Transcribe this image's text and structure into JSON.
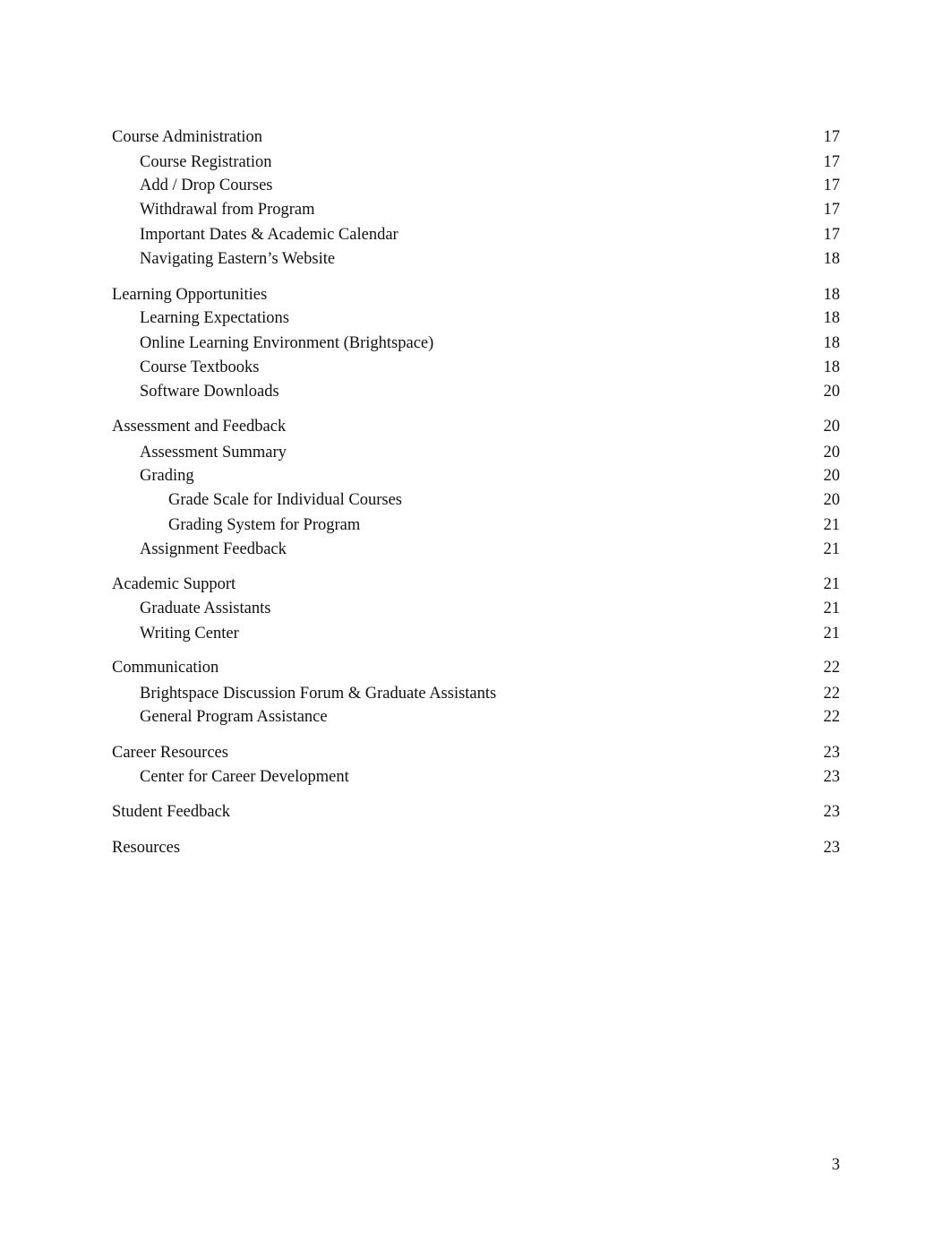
{
  "toc": {
    "entries": [
      {
        "title": "Course Administration",
        "page": "17",
        "level": 1
      },
      {
        "title": "Course Registration",
        "page": "17",
        "level": 2
      },
      {
        "title": "Add / Drop Courses",
        "page": "17",
        "level": 2
      },
      {
        "title": "Withdrawal from Program",
        "page": "17",
        "level": 2
      },
      {
        "title": "Important Dates & Academic Calendar",
        "page": "17",
        "level": 2
      },
      {
        "title": "Navigating Eastern’s Website",
        "page": "18",
        "level": 2
      },
      {
        "title": "Learning Opportunities",
        "page": "18",
        "level": 1
      },
      {
        "title": "Learning Expectations",
        "page": "18",
        "level": 2
      },
      {
        "title": "Online Learning Environment (Brightspace)",
        "page": "18",
        "level": 2
      },
      {
        "title": "Course Textbooks",
        "page": "18",
        "level": 2
      },
      {
        "title": "Software Downloads",
        "page": "20",
        "level": 2
      },
      {
        "title": "Assessment and Feedback",
        "page": "20",
        "level": 1
      },
      {
        "title": "Assessment Summary",
        "page": "20",
        "level": 2
      },
      {
        "title": "Grading",
        "page": "20",
        "level": 2
      },
      {
        "title": "Grade Scale for Individual Courses",
        "page": "20",
        "level": 3
      },
      {
        "title": "Grading System for Program",
        "page": "21",
        "level": 3
      },
      {
        "title": "Assignment Feedback",
        "page": "21",
        "level": 2
      },
      {
        "title": "Academic Support",
        "page": "21",
        "level": 1
      },
      {
        "title": "Graduate Assistants",
        "page": "21",
        "level": 2
      },
      {
        "title": "Writing Center",
        "page": "21",
        "level": 2
      },
      {
        "title": "Communication",
        "page": "22",
        "level": 1
      },
      {
        "title": "Brightspace Discussion Forum & Graduate Assistants",
        "page": "22",
        "level": 2
      },
      {
        "title": "General Program Assistance",
        "page": "22",
        "level": 2
      },
      {
        "title": "Career Resources",
        "page": "23",
        "level": 1
      },
      {
        "title": "Center for Career Development",
        "page": "23",
        "level": 2
      },
      {
        "title": "Student Feedback",
        "page": "23",
        "level": 1
      },
      {
        "title": "Resources",
        "page": "23",
        "level": 1
      }
    ]
  },
  "footer": {
    "page_number": "3"
  }
}
